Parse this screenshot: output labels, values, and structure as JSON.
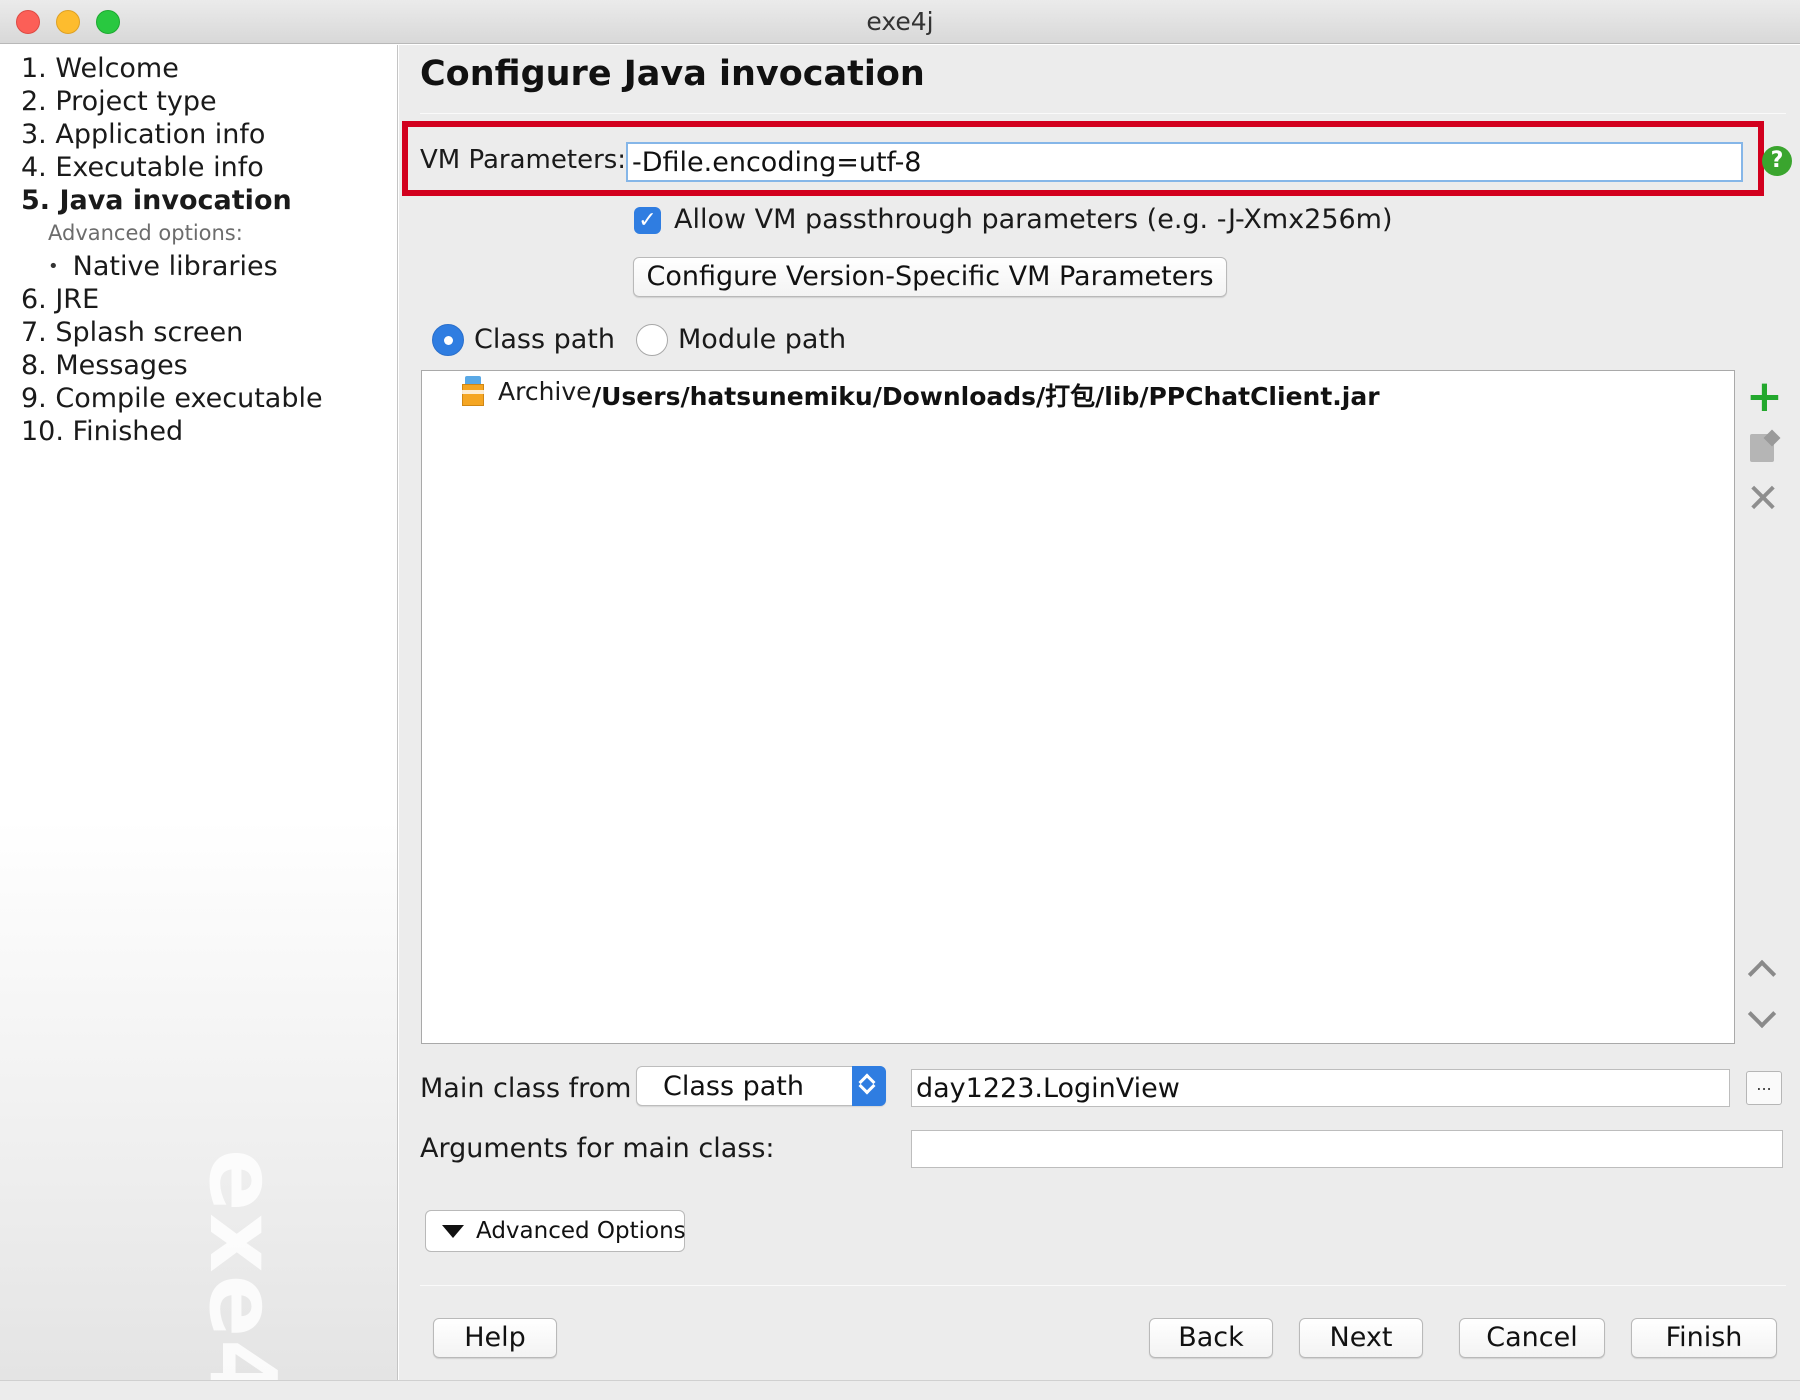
{
  "window": {
    "title": "exe4j"
  },
  "sidebar": {
    "steps": [
      {
        "label": "1. Welcome"
      },
      {
        "label": "2. Project type"
      },
      {
        "label": "3. Application info"
      },
      {
        "label": "4. Executable info"
      },
      {
        "label": "5. Java invocation",
        "active": true
      },
      {
        "label": "6. JRE"
      },
      {
        "label": "7. Splash screen"
      },
      {
        "label": "8. Messages"
      },
      {
        "label": "9. Compile executable"
      },
      {
        "label": "10. Finished"
      }
    ],
    "advanced_label": "Advanced options:",
    "sub_items": [
      {
        "label": "Native libraries"
      }
    ],
    "watermark": "exe4j"
  },
  "main": {
    "title": "Configure Java invocation",
    "vm_parameters": {
      "label": "VM Parameters:",
      "value": "-Dfile.encoding=utf-8"
    },
    "passthrough": {
      "label": "Allow VM passthrough parameters (e.g. -J-Xmx256m)",
      "checked": true
    },
    "version_specific_button": "Configure Version-Specific VM Parameters",
    "path_mode": {
      "options": [
        {
          "label": "Class path",
          "selected": true
        },
        {
          "label": "Module path",
          "selected": false
        }
      ]
    },
    "classpath_entries": [
      {
        "type": "Archive",
        "path": "/Users/hatsunemiku/Downloads/打包/lib/PPChatClient.jar"
      }
    ],
    "main_class_from": {
      "label": "Main class from",
      "selected": "Class path",
      "value": "day1223.LoginView",
      "browse_label": "..."
    },
    "arguments": {
      "label": "Arguments for main class:",
      "value": ""
    },
    "advanced_options_button": "Advanced Options"
  },
  "footer": {
    "help": "Help",
    "back": "Back",
    "next": "Next",
    "cancel": "Cancel",
    "finish": "Finish"
  },
  "colors": {
    "accent": "#2f7de1",
    "highlight_border": "#d2001e",
    "add_icon": "#23a82d",
    "help_icon": "#3aa52e"
  },
  "icons": {
    "help": "question-circle-icon",
    "add": "plus-icon",
    "edit": "edit-icon",
    "delete": "x-icon",
    "move_up": "chevron-up-icon",
    "move_down": "chevron-down-icon",
    "archive": "jar-archive-icon"
  }
}
